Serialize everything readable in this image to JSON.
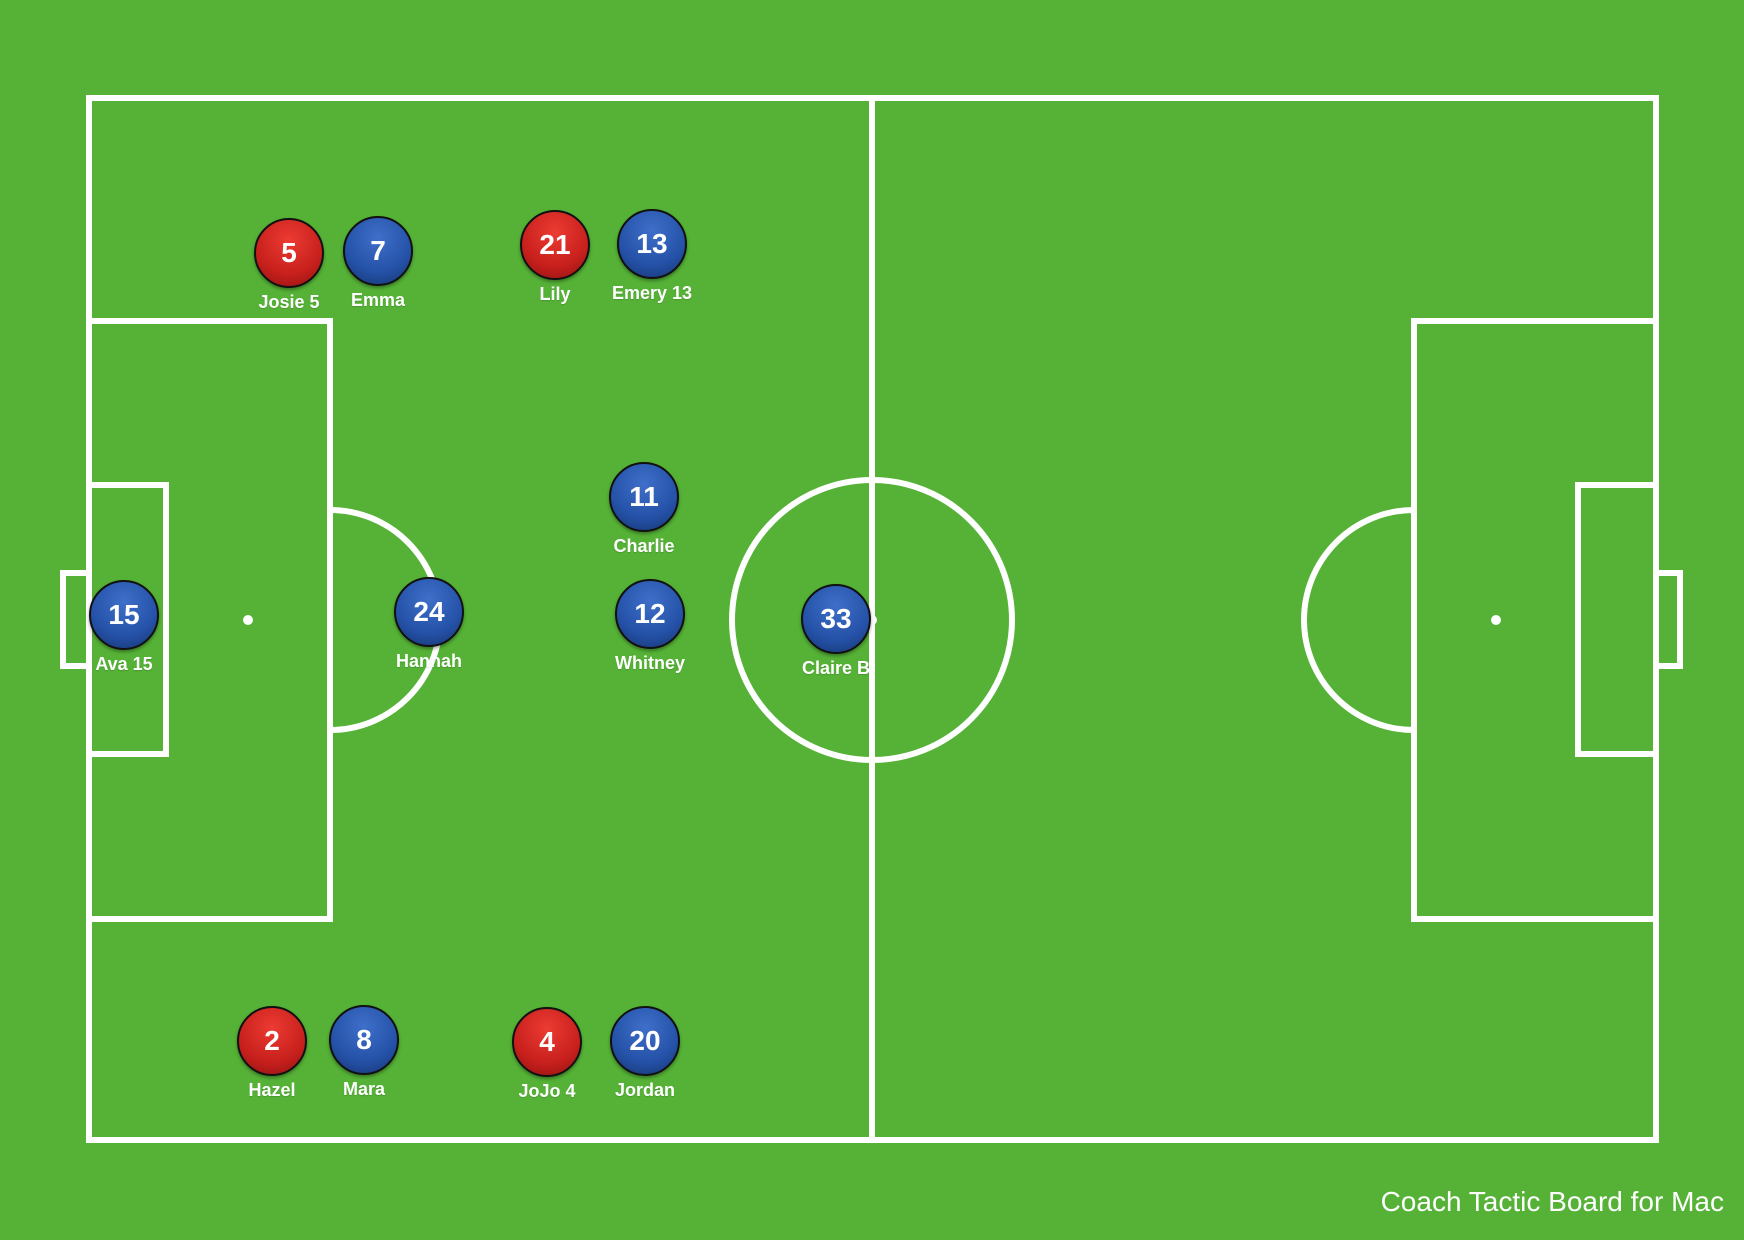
{
  "app": {
    "watermark": "Coach Tactic Board for Mac"
  },
  "colors": {
    "field": "#55b236",
    "lines": "#ffffff",
    "team_red": "#d0261f",
    "team_blue": "#2552a8"
  },
  "players": [
    {
      "number": "5",
      "name": "Josie 5",
      "team": "red"
    },
    {
      "number": "7",
      "name": "Emma",
      "team": "blue"
    },
    {
      "number": "21",
      "name": "Lily",
      "team": "red"
    },
    {
      "number": "13",
      "name": "Emery 13",
      "team": "blue"
    },
    {
      "number": "11",
      "name": "Charlie",
      "team": "blue"
    },
    {
      "number": "15",
      "name": "Ava 15",
      "team": "blue"
    },
    {
      "number": "24",
      "name": "Hannah",
      "team": "blue"
    },
    {
      "number": "12",
      "name": "Whitney",
      "team": "blue"
    },
    {
      "number": "33",
      "name": "Claire B",
      "team": "blue"
    },
    {
      "number": "2",
      "name": "Hazel",
      "team": "red"
    },
    {
      "number": "8",
      "name": "Mara",
      "team": "blue"
    },
    {
      "number": "4",
      "name": "JoJo 4",
      "team": "red"
    },
    {
      "number": "20",
      "name": "Jordan",
      "team": "blue"
    }
  ]
}
